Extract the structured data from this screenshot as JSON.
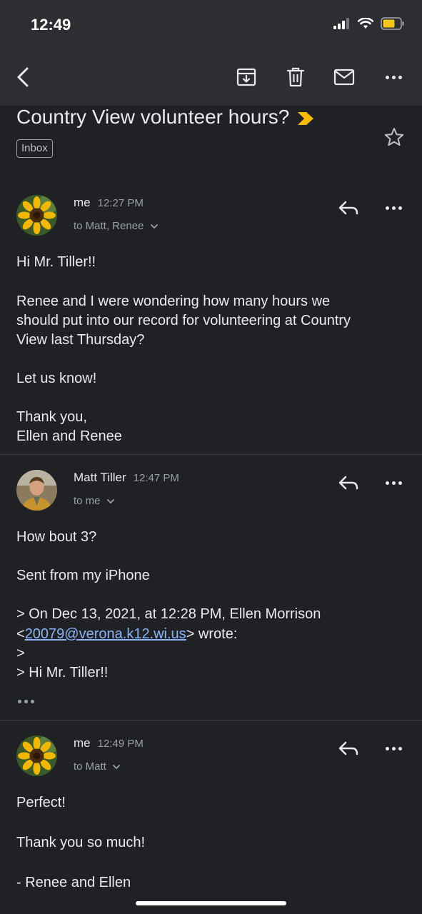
{
  "status": {
    "time": "12:49"
  },
  "subject": {
    "text": "Country View volunteer hours?",
    "label": "Inbox"
  },
  "messages": [
    {
      "sender": "me",
      "time": "12:27 PM",
      "recipients": "to Matt, Renee",
      "body": [
        "Hi Mr. Tiller!!",
        "Renee and I were wondering how many hours we",
        "should put into our record for volunteering at Country",
        "View last Thursday?",
        "Let us know!",
        "Thank you,",
        "Ellen and Renee"
      ]
    },
    {
      "sender": "Matt Tiller",
      "time": "12:47 PM",
      "recipients": "to me",
      "body": [
        "How bout 3?",
        "Sent from my iPhone",
        "> On Dec 13, 2021, at 12:28 PM, Ellen Morrison",
        "<",
        "20079@verona.k12.wi.us",
        "> wrote:",
        ">",
        "> Hi Mr. Tiller!!"
      ]
    },
    {
      "sender": "me",
      "time": "12:49 PM",
      "recipients": "to Matt",
      "body": [
        "Perfect!",
        "Thank you so much!",
        "- Renee and Ellen"
      ]
    }
  ],
  "colors": {
    "background": "#202124",
    "toolbar": "#2d2e31",
    "importance": "#fbbc04",
    "link": "#8ab4f8"
  }
}
